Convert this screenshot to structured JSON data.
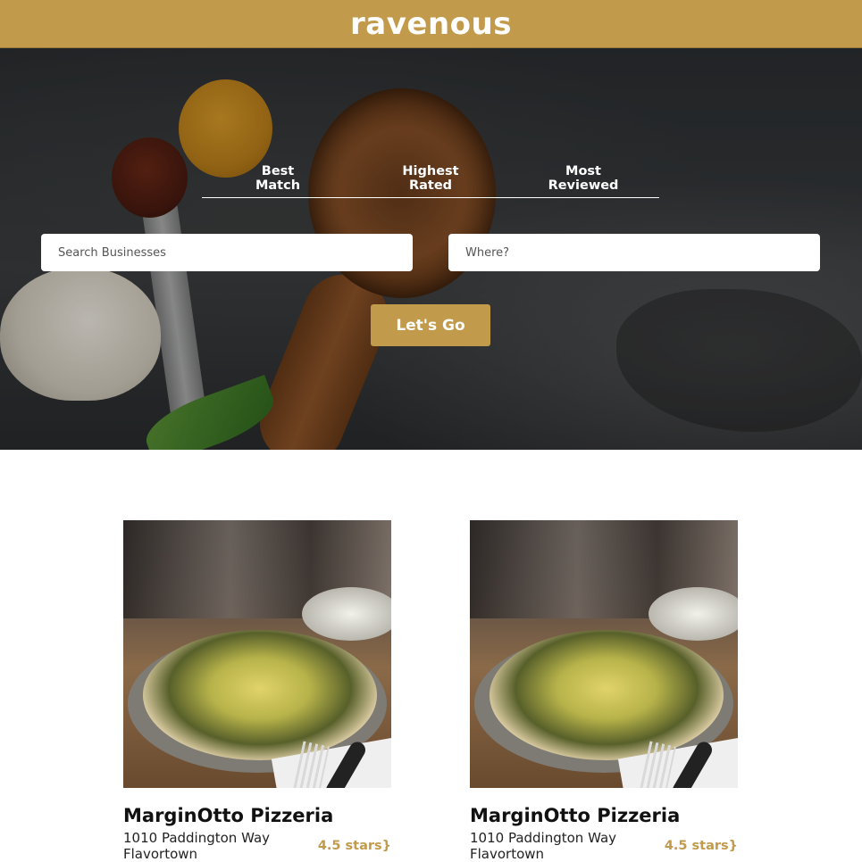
{
  "header": {
    "brand": "ravenous"
  },
  "search": {
    "sort_options": [
      {
        "line1": "Best",
        "line2": "Match"
      },
      {
        "line1": "Highest",
        "line2": "Rated"
      },
      {
        "line1": "Most",
        "line2": "Reviewed"
      }
    ],
    "term_placeholder": "Search Businesses",
    "location_placeholder": "Where?",
    "submit_label": "Let's Go"
  },
  "businesses": [
    {
      "name": "MarginOtto Pizzeria",
      "address_line1": "1010 Paddington Way",
      "address_line2": "Flavortown",
      "rating": "4.5 stars}"
    },
    {
      "name": "MarginOtto Pizzeria",
      "address_line1": "1010 Paddington Way",
      "address_line2": "Flavortown",
      "rating": "4.5 stars}"
    }
  ],
  "colors": {
    "accent": "#c29a4b"
  }
}
